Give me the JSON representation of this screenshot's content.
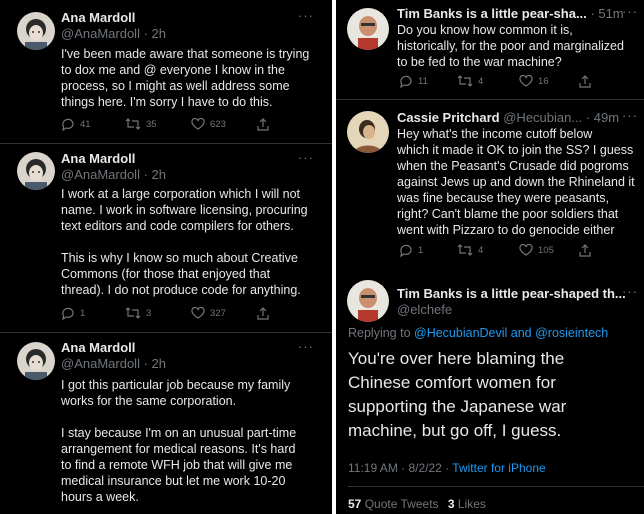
{
  "colors": {
    "background": "#000000",
    "text": "#e7e9ea",
    "muted": "#71767b",
    "link": "#1d9bf0",
    "divider": "#2f3336"
  },
  "left": {
    "tweets": [
      {
        "name": "Ana Mardoll",
        "handle": "@AnaMardoll · 2h",
        "text": "I've been made aware that someone is trying\nto dox me and @ everyone I know in the\nprocess, so I might as well address some\nthings here. I'm sorry I have to do this.",
        "replies": "41",
        "retweets": "35",
        "likes": "623"
      },
      {
        "name": "Ana Mardoll",
        "handle": "@AnaMardoll · 2h",
        "text": "I work at a large corporation which I will not\nname. I work in software licensing, procuring\ntext editors and code compilers for others.\n\nThis is why I know so much about Creative\nCommons (for those that enjoyed that\nthread). I do not produce code for anything.",
        "replies": "1",
        "retweets": "3",
        "likes": "327"
      },
      {
        "name": "Ana Mardoll",
        "handle": "@AnaMardoll · 2h",
        "text": "I got this particular job because my family\nworks for the same corporation.\n\nI stay because I'm on an unusual part-time\narrangement for medical reasons. It's hard\nto find a remote WFH job that will give me\nmedical insurance but let me work 10-20\nhours a week."
      }
    ]
  },
  "right": {
    "tweets": [
      {
        "name": "Tim Banks is a little pear-sha...",
        "handle": "· 51m",
        "text": "Do you know how common it is,\nhistorically, for the poor and marginalized\nto be fed to the war machine?",
        "replies": "11",
        "retweets": "4",
        "likes": "16"
      },
      {
        "name": "Cassie Pritchard",
        "handle": "@Hecubian... · 49m",
        "text": "Hey what's the income cutoff below\nwhich it made it OK to join the SS? I guess\nwhen the Peasant's Crusade did pogroms\nagainst Jews up and down the Rhineland it\nwas fine because they were peasants,\nright? Can't blame the poor soldiers that\nwent with Pizzaro to do genocide either",
        "replies": "1",
        "retweets": "4",
        "likes": "105"
      }
    ],
    "main": {
      "name": "Tim Banks is a little pear-shaped th...",
      "handle": "@elchefe",
      "replying_prefix": "Replying to ",
      "replying_to": "@HecubianDevil and @rosieintech",
      "text": "You're over here blaming the\nChinese comfort women for\nsupporting the Japanese war\nmachine, but go off, I guess.",
      "timestamp": "11:19 AM · 8/2/22 · ",
      "source": "Twitter for iPhone",
      "quote_count": "57",
      "quote_label": "Quote Tweets",
      "like_count": "3",
      "like_label": "Likes"
    }
  }
}
